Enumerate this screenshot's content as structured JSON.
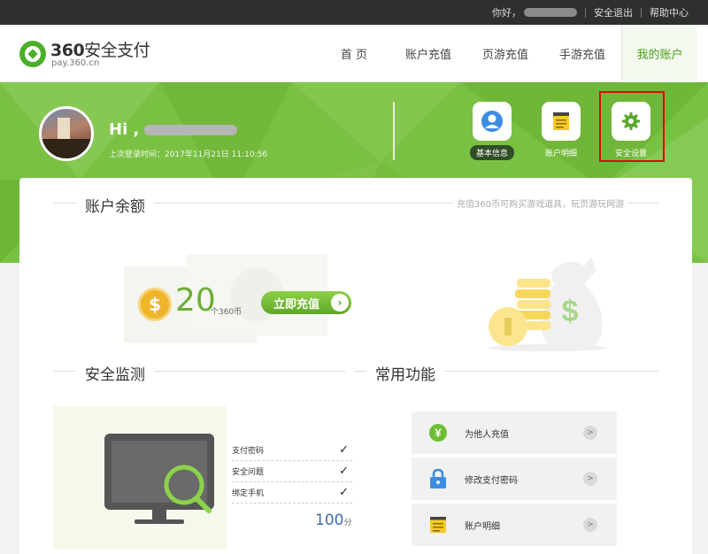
{
  "topbar": {
    "greeting": "你好，",
    "logout": "安全退出",
    "help": "帮助中心"
  },
  "brand": {
    "name_num": "360",
    "name_zh": "安全支付",
    "domain": "pay.360.cn",
    "color": "#4caf2a"
  },
  "nav": {
    "items": [
      {
        "label": "首 页"
      },
      {
        "label": "账户充值"
      },
      {
        "label": "页游充值"
      },
      {
        "label": "手游充值"
      },
      {
        "label": "我的账户"
      }
    ]
  },
  "user": {
    "hi": "Hi ,",
    "last_login": "上次登录时间：2017年11月21日 11:10:56"
  },
  "quick": {
    "items": [
      {
        "label": "基本信息",
        "icon": "user-icon"
      },
      {
        "label": "账户明细",
        "icon": "notepad-icon"
      },
      {
        "label": "安全设置",
        "icon": "gear-icon"
      }
    ]
  },
  "balance": {
    "title": "账户余额",
    "tip": "充值360币可购买游戏道具，玩页游玩网游",
    "coin_symbol": "$",
    "amount": "20",
    "unit": "个360币",
    "recharge": "立即充值",
    "arrow": "›"
  },
  "security": {
    "title": "安全监测",
    "tick": "✓",
    "checks": [
      {
        "label": "支付密码"
      },
      {
        "label": "安全问题"
      },
      {
        "label": "绑定手机"
      }
    ],
    "score": "100",
    "score_unit": "分"
  },
  "functions": {
    "title": "常用功能",
    "arrow": ">",
    "items": [
      {
        "label": "为他人充值",
        "icon": "yen-icon"
      },
      {
        "label": "修改支付密码",
        "icon": "lock-icon"
      },
      {
        "label": "账户明细",
        "icon": "notepad-icon"
      }
    ]
  },
  "colors": {
    "accent_green": "#7ac143",
    "highlight_red": "#d90c0c"
  }
}
